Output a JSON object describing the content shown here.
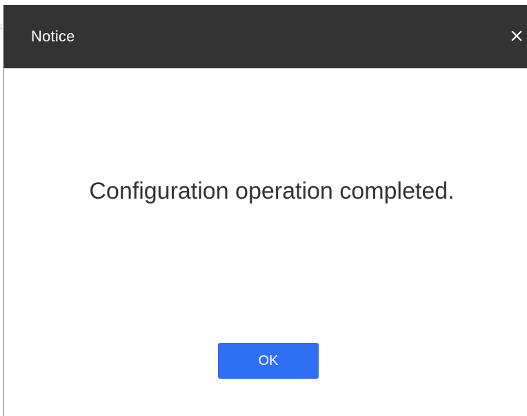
{
  "dialog": {
    "title": "Notice",
    "close_icon": "close-icon",
    "message": "Configuration operation completed.",
    "ok_label": "OK"
  },
  "colors": {
    "titlebar_bg": "#333333",
    "title_text": "#ffffff",
    "message_text": "#333333",
    "ok_button_bg": "#2f6ff3",
    "ok_button_text": "#ffffff"
  }
}
